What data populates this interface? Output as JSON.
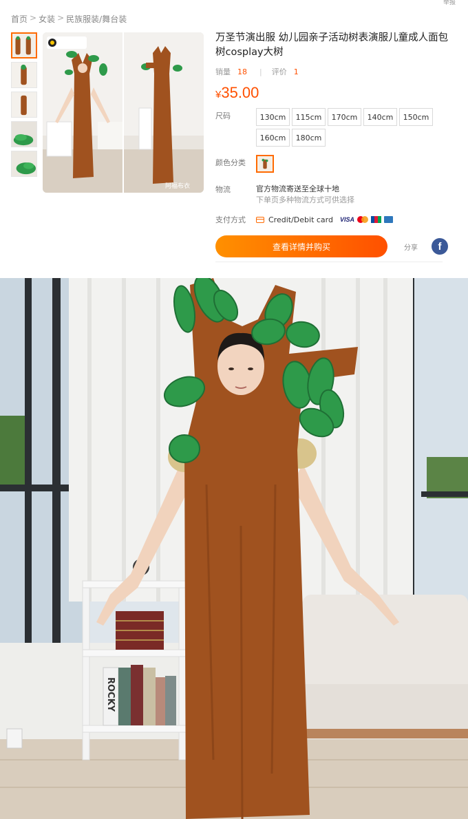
{
  "top_right_link": "举报",
  "breadcrumb": [
    "首页",
    "女装",
    "民族服装/舞台装"
  ],
  "breadcrumb_sep": ">",
  "product": {
    "title": "万圣节演出服 幼儿园亲子活动树表演服儿童成人面包树cosplay大树",
    "sales_label": "销量",
    "sales_count": "18",
    "review_label": "评价",
    "review_count": "1",
    "separator": "|",
    "currency": "¥",
    "price": "35.00"
  },
  "options": {
    "size_label": "尺码",
    "sizes": [
      "130cm",
      "115cm",
      "170cm",
      "140cm",
      "150cm",
      "160cm",
      "180cm"
    ],
    "color_label": "颜色分类",
    "color_selected_icon": "tree-costume-thumbnail"
  },
  "logistics": {
    "label": "物流",
    "line1": "官方物流寄送至全球十地",
    "line2": "下单页多种物流方式可供选择"
  },
  "payment": {
    "label": "支付方式",
    "method": "Credit/Debit card",
    "visa_text": "VISA"
  },
  "actions": {
    "buy_label": "查看详情并购买",
    "share_label": "分享",
    "facebook_glyph": "f"
  },
  "main_image": {
    "watermark": "阿福布衣"
  },
  "detail_image": {
    "book_label": "ROCKY"
  },
  "colors": {
    "accent": "#ff5000",
    "button_start": "#ff9000",
    "button_end": "#ff5000",
    "facebook": "#3b5998",
    "costume_brown": "#a0521f",
    "leaf_green": "#2e9a4a"
  }
}
